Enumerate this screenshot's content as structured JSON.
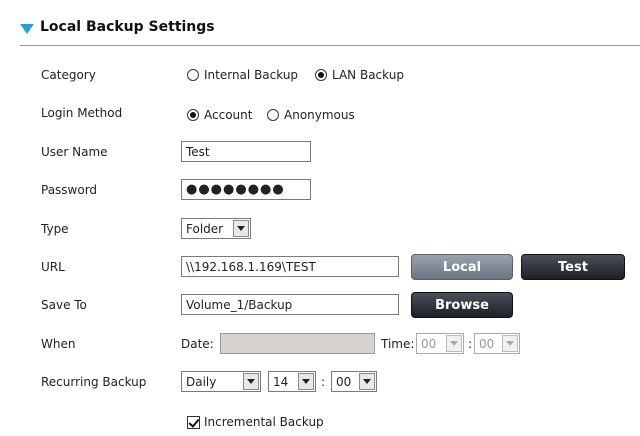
{
  "section": {
    "title": "Local Backup Settings",
    "accent_color": "#22a3d8"
  },
  "form": {
    "category": {
      "label": "Category",
      "options": [
        "Internal Backup",
        "LAN Backup"
      ],
      "selected": "LAN Backup"
    },
    "login_method": {
      "label": "Login Method",
      "options": [
        "Account",
        "Anonymous"
      ],
      "selected": "Account"
    },
    "user_name": {
      "label": "User Name",
      "value": "Test"
    },
    "password": {
      "label": "Password",
      "value": "●●●●●●●●"
    },
    "type": {
      "label": "Type",
      "value": "Folder"
    },
    "url": {
      "label": "URL",
      "value": "\\\\192.168.1.169\\TEST",
      "local_button": "Local",
      "test_button": "Test"
    },
    "save_to": {
      "label": "Save To",
      "value": "Volume_1/Backup",
      "browse_button": "Browse"
    },
    "when": {
      "label": "When",
      "date_label": "Date:",
      "date_value": "",
      "time_label": "Time:",
      "hour": "00",
      "minute": "00"
    },
    "recurring": {
      "label": "Recurring Backup",
      "frequency": "Daily",
      "hour": "14",
      "separator": ":",
      "minute": "00"
    },
    "incremental": {
      "label": "Incremental Backup",
      "checked": true
    }
  }
}
